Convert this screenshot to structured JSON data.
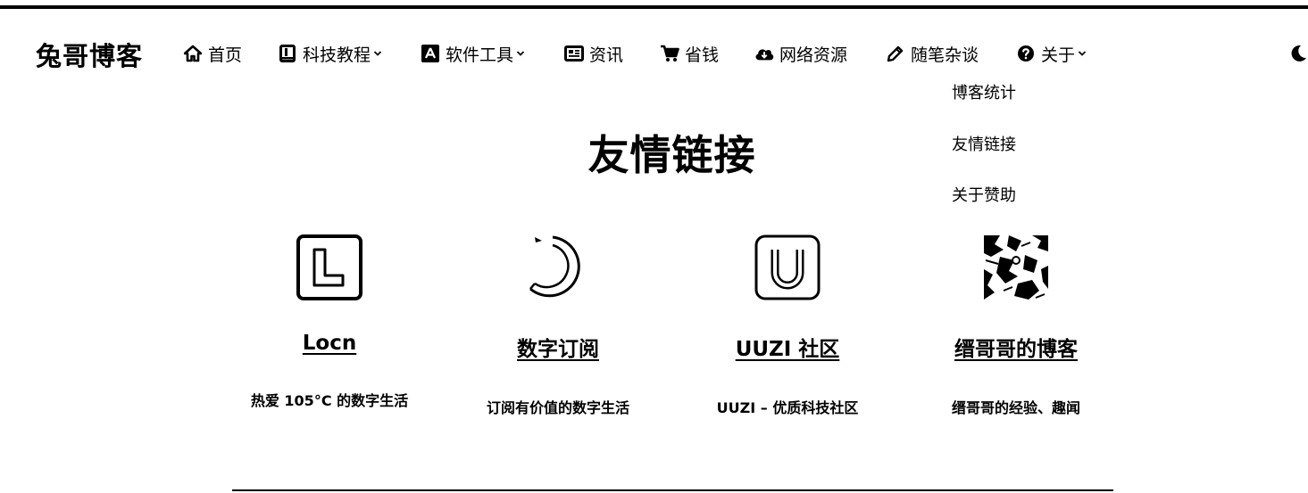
{
  "site": {
    "title": "兔哥博客"
  },
  "nav": {
    "items": [
      {
        "label": "首页",
        "icon": "home-icon",
        "dropdown": false
      },
      {
        "label": "科技教程",
        "icon": "book-icon",
        "dropdown": true
      },
      {
        "label": "软件工具",
        "icon": "app-store-icon",
        "dropdown": true
      },
      {
        "label": "资讯",
        "icon": "newspaper-icon",
        "dropdown": false
      },
      {
        "label": "省钱",
        "icon": "cart-icon",
        "dropdown": false
      },
      {
        "label": "网络资源",
        "icon": "cloud-download-icon",
        "dropdown": false
      },
      {
        "label": "随笔杂谈",
        "icon": "pencil-icon",
        "dropdown": false
      },
      {
        "label": "关于",
        "icon": "question-circle-icon",
        "dropdown": true
      }
    ],
    "theme_toggle_icon": "moon-icon"
  },
  "about_menu": {
    "items": [
      "博客统计",
      "友情链接",
      "关于赞助"
    ]
  },
  "page": {
    "title": "友情链接"
  },
  "links": [
    {
      "name": "Locn",
      "desc": "热爱 105°C 的数字生活",
      "logo": "letter-l-logo"
    },
    {
      "name": "数字订阅",
      "desc": "订阅有价值的数字生活",
      "logo": "crescent-logo"
    },
    {
      "name": "UUZI 社区",
      "desc": "UUZI – 优质科技社区",
      "logo": "letter-u-logo"
    },
    {
      "name": "缙哥哥的博客",
      "desc": "缙哥哥的经验、趣闻",
      "logo": "photo-avatar"
    }
  ]
}
